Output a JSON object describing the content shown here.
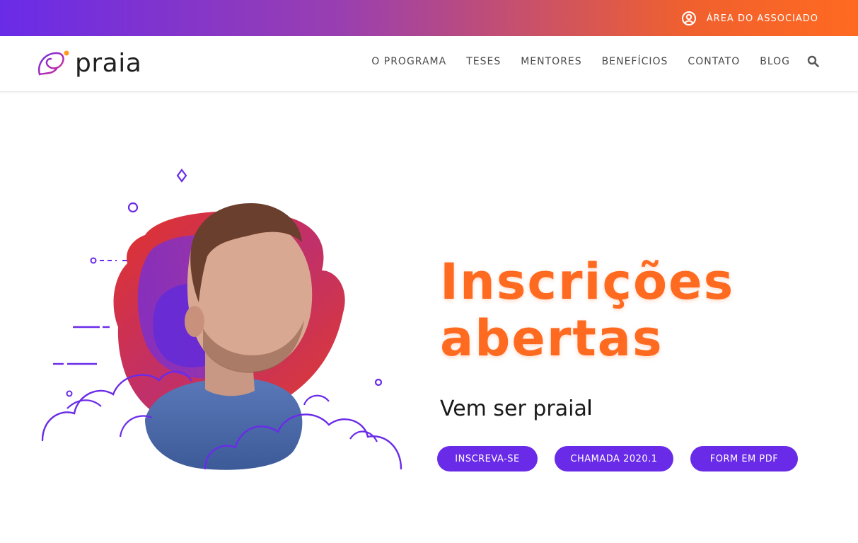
{
  "topbar": {
    "member_area_label": "ÁREA DO ASSOCIADO",
    "member_icon": "user-circle-icon",
    "gradient_start": "#6a2be8",
    "gradient_end": "#ff6a21"
  },
  "header": {
    "logo_text": "praia",
    "nav": [
      {
        "label": "O PROGRAMA"
      },
      {
        "label": "TESES"
      },
      {
        "label": "MENTORES"
      },
      {
        "label": "BENEFÍCIOS"
      },
      {
        "label": "CONTATO"
      },
      {
        "label": "BLOG"
      }
    ],
    "search_icon": "search-icon"
  },
  "hero": {
    "title_line1": "Inscrições",
    "title_line2": "abertas",
    "subtitle": "Vem ser pr",
    "subtitle_typing": "aia",
    "buttons": [
      {
        "label": "INSCREVA-SE"
      },
      {
        "label": "CHAMADA 2020.1"
      },
      {
        "label": "FORM EM PDF"
      }
    ]
  },
  "colors": {
    "accent_orange": "#ff6a21",
    "accent_purple": "#6a2be8"
  }
}
